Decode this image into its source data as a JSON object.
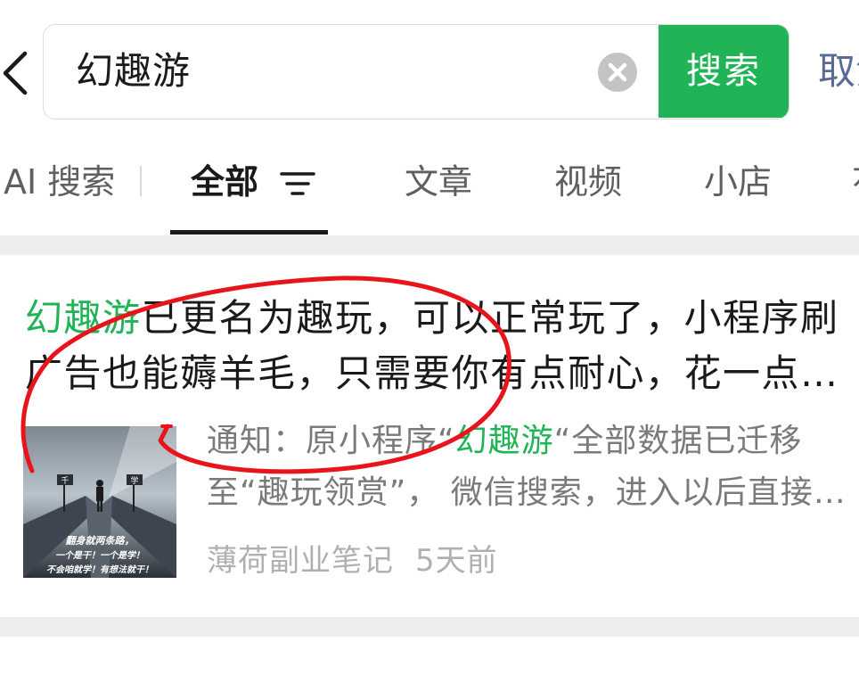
{
  "search": {
    "query": "幻趣游",
    "button_label": "搜索",
    "cancel_label": "取消"
  },
  "tabs": [
    {
      "label": "AI 搜索"
    },
    {
      "label": "全部",
      "active": true
    },
    {
      "label": "文章"
    },
    {
      "label": "视频"
    },
    {
      "label": "小店"
    },
    {
      "label": "花"
    }
  ],
  "result": {
    "title_highlight": "幻趣游",
    "title_rest": "已更名为趣玩，可以正常玩了，小程序刷广告也能薅羊毛，只需要你有点耐心，花一点时间",
    "snippet_prefix": "通知：原小程序“",
    "snippet_highlight": "幻趣游",
    "snippet_rest": "“全部数据已迁移至“趣玩领赏”， 微信搜索，进入以后直接登录",
    "source": "薄荷副业笔记",
    "time": "5天前",
    "thumbnail": {
      "sign_left": "千",
      "sign_right": "学",
      "line1": "翻身就两条路，",
      "line2": "一个是干！一个是学！",
      "line3": "不会咱就学！有想法就干！"
    }
  },
  "colors": {
    "accent_green": "#20b457",
    "link_blue": "#576b95",
    "annotation_red": "#e8141c"
  },
  "icons": [
    "back-arrow-icon",
    "clear-icon",
    "filter-icon"
  ]
}
